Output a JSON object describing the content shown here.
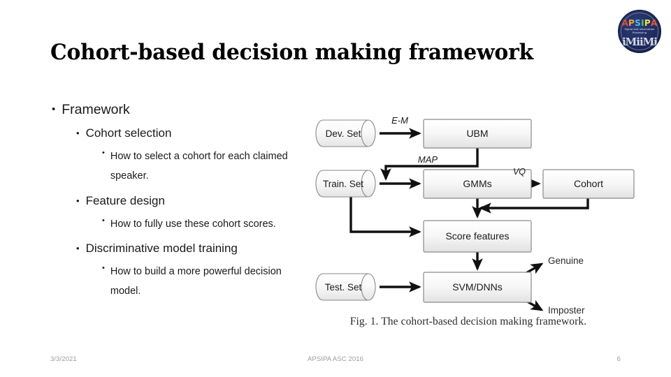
{
  "slide": {
    "title": "Cohort-based decision making framework",
    "page_number": "6"
  },
  "logo": {
    "name": "apsipa-logo",
    "wordmark": "APSIPA",
    "wordmark_letters": [
      "A",
      "P",
      "S",
      "I",
      "P",
      "A"
    ],
    "subtitle_line1": "Signal and Information",
    "subtitle_line2": "Processing",
    "colors": {
      "background": "#1d2a5c",
      "letter_a1": "#e34b3c",
      "letter_p1": "#f2a13b",
      "letter_s": "#4fc0e8",
      "letter_i": "#5ec26a",
      "letter_p2": "#f2e14b",
      "letter_a2": "#e8563f"
    }
  },
  "bullets": [
    {
      "level": 1,
      "marker": "•",
      "text": "Framework"
    },
    {
      "level": 2,
      "marker": "•",
      "text": "Cohort selection"
    },
    {
      "level": 3,
      "marker": "•",
      "text": "How to select a cohort for each claimed speaker."
    },
    {
      "level": 2,
      "marker": "•",
      "text": "Feature design"
    },
    {
      "level": 3,
      "marker": "•",
      "text": "How to fully use these cohort scores."
    },
    {
      "level": 2,
      "marker": "•",
      "text": "Discriminative model training"
    },
    {
      "level": 3,
      "marker": "•",
      "text": "How to build a more powerful decision model."
    }
  ],
  "figure": {
    "caption": "Fig. 1. The cohort-based decision making framework.",
    "nodes": [
      {
        "id": "dev_set",
        "label": "Dev. Set",
        "shape": "cylinder"
      },
      {
        "id": "ubm",
        "label": "UBM",
        "shape": "box"
      },
      {
        "id": "train_set",
        "label": "Train. Set",
        "shape": "cylinder"
      },
      {
        "id": "gmms",
        "label": "GMMs",
        "shape": "box"
      },
      {
        "id": "cohort",
        "label": "Cohort",
        "shape": "box"
      },
      {
        "id": "score_features",
        "label": "Score features",
        "shape": "box"
      },
      {
        "id": "test_set",
        "label": "Test. Set",
        "shape": "cylinder"
      },
      {
        "id": "svm_dnns",
        "label": "SVM/DNNs",
        "shape": "box"
      },
      {
        "id": "genuine",
        "label": "Genuine",
        "shape": "text"
      },
      {
        "id": "imposter",
        "label": "Imposter",
        "shape": "text"
      }
    ],
    "edge_labels": [
      {
        "id": "em",
        "label": "E-M"
      },
      {
        "id": "map",
        "label": "MAP"
      },
      {
        "id": "vq",
        "label": "VQ"
      }
    ]
  },
  "footer": {
    "date": "3/3/2021",
    "center": "APSIPA ASC 2016",
    "page": "6"
  }
}
